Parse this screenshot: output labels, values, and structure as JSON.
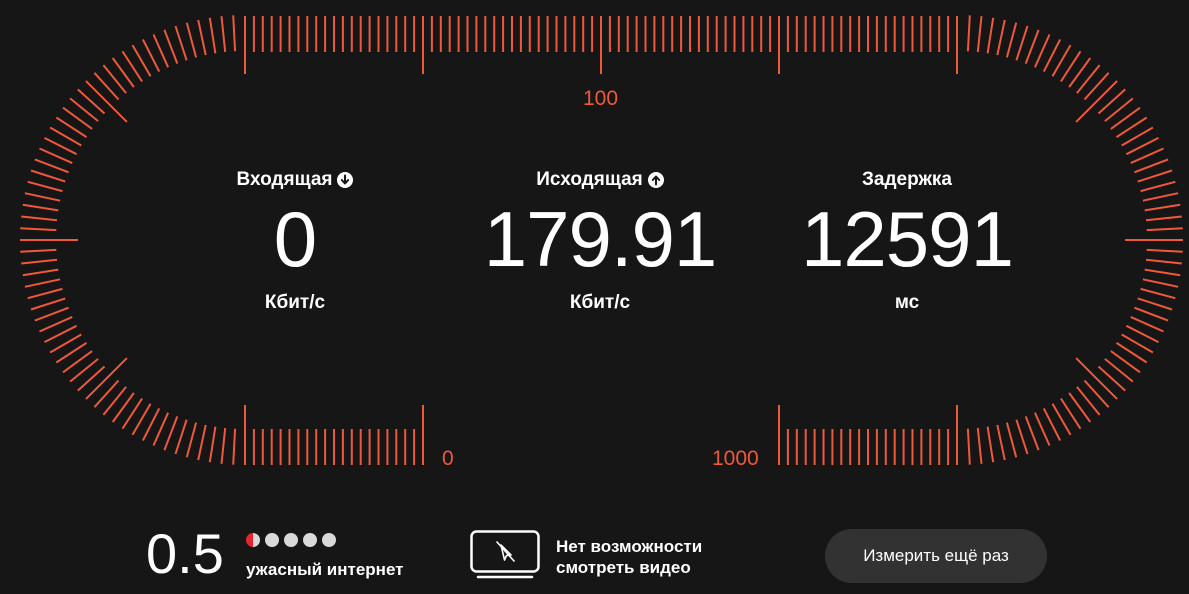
{
  "colors": {
    "accent": "#f0583a",
    "background": "#161616",
    "button_bg": "#323232",
    "rating_active": "#e8242e",
    "rating_inactive": "#d9d9dc"
  },
  "gauge": {
    "upload_scale_top": "100",
    "download_scale_start": "0",
    "upload_scale_end": "1000"
  },
  "metrics": {
    "download": {
      "title": "Входящая",
      "icon": "arrow-down-circle-icon",
      "value": "0",
      "unit": "Кбит/с"
    },
    "upload": {
      "title": "Исходящая",
      "icon": "arrow-up-circle-icon",
      "value": "179.91",
      "unit": "Кбит/с"
    },
    "latency": {
      "title": "Задержка",
      "value": "12591",
      "unit": "мс"
    }
  },
  "rating": {
    "score": "0.5",
    "max_dots": 5,
    "filled_fraction": 0.1,
    "label": "ужасный интернет"
  },
  "video": {
    "icon": "no-video-icon",
    "line1": "Нет возможности",
    "line2": "смотреть видео"
  },
  "actions": {
    "retry_label": "Измерить ещё раз"
  }
}
